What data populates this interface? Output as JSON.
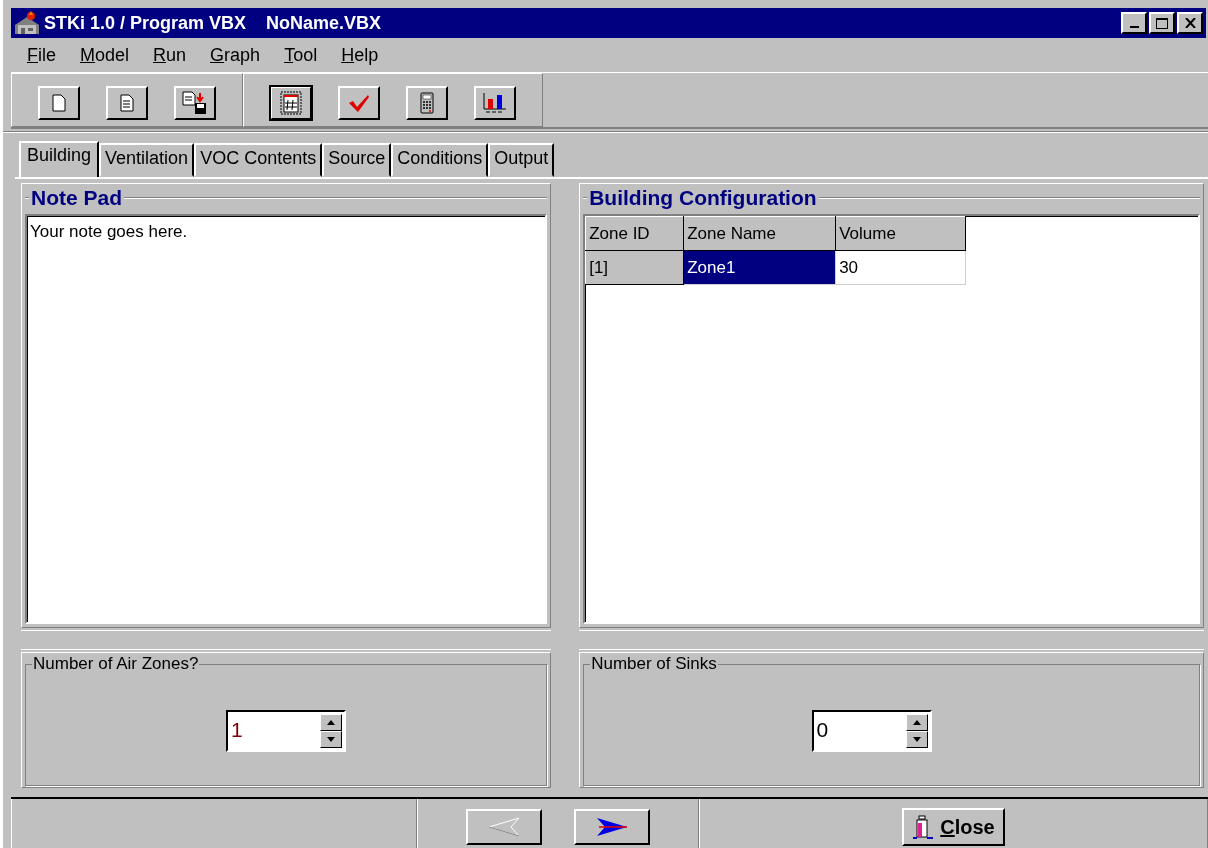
{
  "window": {
    "title": "STKi 1.0 / Program VBX    NoName.VBX"
  },
  "menu": [
    {
      "label": "File"
    },
    {
      "label": "Model"
    },
    {
      "label": "Run"
    },
    {
      "label": "Graph"
    },
    {
      "label": "Tool"
    },
    {
      "label": "Help"
    }
  ],
  "toolbar": [
    [
      {
        "kind": "new",
        "focused": false
      },
      {
        "kind": "document",
        "focused": false
      },
      {
        "kind": "save",
        "focused": false
      }
    ],
    [
      {
        "kind": "grid",
        "focused": true
      },
      {
        "kind": "check",
        "focused": false
      },
      {
        "kind": "calculator",
        "focused": false
      },
      {
        "kind": "chart",
        "focused": false
      }
    ]
  ],
  "tabs": [
    {
      "label": "Building",
      "selected": true
    },
    {
      "label": "Ventilation",
      "selected": false
    },
    {
      "label": "VOC Contents",
      "selected": false
    },
    {
      "label": "Source",
      "selected": false
    },
    {
      "label": "Conditions",
      "selected": false
    },
    {
      "label": "Output",
      "selected": false
    }
  ],
  "note_pad": {
    "title": "Note Pad",
    "text": "Your note goes here."
  },
  "building_configuration": {
    "title": "Building Configuration",
    "columns": [
      "Zone ID",
      "Zone Name",
      "Volume"
    ],
    "rows": [
      {
        "cells": [
          {
            "kind": "header",
            "text": "[1]",
            "selected": false
          },
          {
            "kind": "data",
            "text": "Zone1",
            "selected": true
          },
          {
            "kind": "data",
            "text": "30",
            "selected": false
          }
        ]
      }
    ]
  },
  "spinners": [
    {
      "label": "Number of Air Zones?",
      "value": "1",
      "color": "#800000"
    },
    {
      "label": "Number of Sinks",
      "value": "0",
      "color": "#000000"
    }
  ],
  "footer": {
    "back": {
      "disabled": true
    },
    "next": {
      "disabled": false
    },
    "close": {
      "label": "Close"
    }
  }
}
